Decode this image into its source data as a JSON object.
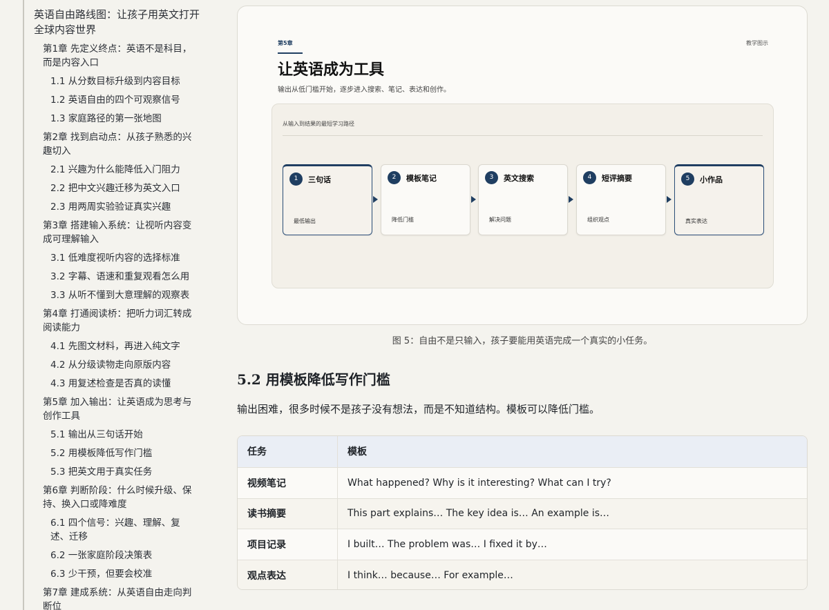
{
  "toc": [
    {
      "level": "book",
      "label": "英语自由路线图：让孩子用英文打开全球内容世界"
    },
    {
      "level": "chap",
      "label": "第1章 先定义终点：英语不是科目，而是内容入口"
    },
    {
      "level": "sec",
      "label": "1.1 从分数目标升级到内容目标"
    },
    {
      "level": "sec",
      "label": "1.2 英语自由的四个可观察信号"
    },
    {
      "level": "sec",
      "label": "1.3 家庭路径的第一张地图"
    },
    {
      "level": "chap",
      "label": "第2章 找到启动点：从孩子熟悉的兴趣切入"
    },
    {
      "level": "sec",
      "label": "2.1 兴趣为什么能降低入门阻力"
    },
    {
      "level": "sec",
      "label": "2.2 把中文兴趣迁移为英文入口"
    },
    {
      "level": "sec",
      "label": "2.3 用两周实验验证真实兴趣"
    },
    {
      "level": "chap",
      "label": "第3章 搭建输入系统：让视听内容变成可理解输入"
    },
    {
      "level": "sec",
      "label": "3.1 低难度视听内容的选择标准"
    },
    {
      "level": "sec",
      "label": "3.2 字幕、语速和重复观看怎么用"
    },
    {
      "level": "sec",
      "label": "3.3 从听不懂到大意理解的观察表"
    },
    {
      "level": "chap",
      "label": "第4章 打通阅读桥：把听力词汇转成阅读能力"
    },
    {
      "level": "sec",
      "label": "4.1 先图文材料，再进入纯文字"
    },
    {
      "level": "sec",
      "label": "4.2 从分级读物走向原版内容"
    },
    {
      "level": "sec",
      "label": "4.3 用复述检查是否真的读懂"
    },
    {
      "level": "chap",
      "label": "第5章 加入输出：让英语成为思考与创作工具"
    },
    {
      "level": "sec",
      "label": "5.1 输出从三句话开始"
    },
    {
      "level": "sec",
      "label": "5.2 用模板降低写作门槛"
    },
    {
      "level": "sec",
      "label": "5.3 把英文用于真实任务"
    },
    {
      "level": "chap",
      "label": "第6章 判断阶段：什么时候升级、保持、换入口或降难度"
    },
    {
      "level": "sec",
      "label": "6.1 四个信号：兴趣、理解、复述、迁移"
    },
    {
      "level": "sec",
      "label": "6.2 一张家庭阶段决策表"
    },
    {
      "level": "sec",
      "label": "6.3 少干预，但要会校准"
    },
    {
      "level": "chap",
      "label": "第7章 建成系统：从英语自由走向判断位"
    }
  ],
  "figure": {
    "chapter": "第5章",
    "tag": "教学图示",
    "title": "让英语成为工具",
    "subtitle": "输出从低门槛开始，逐步进入搜索、笔记、表达和创作。",
    "panel_label": "从输入到结果的最短学习路径",
    "steps": [
      {
        "num": "1",
        "title": "三句话",
        "desc": "最低输出"
      },
      {
        "num": "2",
        "title": "模板笔记",
        "desc": "降低门槛"
      },
      {
        "num": "3",
        "title": "英文搜索",
        "desc": "解决问题"
      },
      {
        "num": "4",
        "title": "短评摘要",
        "desc": "组织观点"
      },
      {
        "num": "5",
        "title": "小作品",
        "desc": "真实表达"
      }
    ],
    "caption": "图 5：自由不是只输入，孩子要能用英语完成一个真实的小任务。"
  },
  "section": {
    "heading": "5.2 用模板降低写作门槛",
    "paragraph": "输出困难，很多时候不是孩子没有想法，而是不知道结构。模板可以降低门槛。"
  },
  "table": {
    "headers": [
      "任务",
      "模板"
    ],
    "rows": [
      [
        "视频笔记",
        "What happened? Why is it interesting? What can I try?"
      ],
      [
        "读书摘要",
        "This part explains… The key idea is… An example is…"
      ],
      [
        "项目记录",
        "I built… The problem was… I fixed it by…"
      ],
      [
        "观点表达",
        "I think… because… For example…"
      ]
    ]
  },
  "colors": {
    "accent": "#1f3e61",
    "background": "#f4f3ee",
    "table_header": "#eaeef5"
  }
}
